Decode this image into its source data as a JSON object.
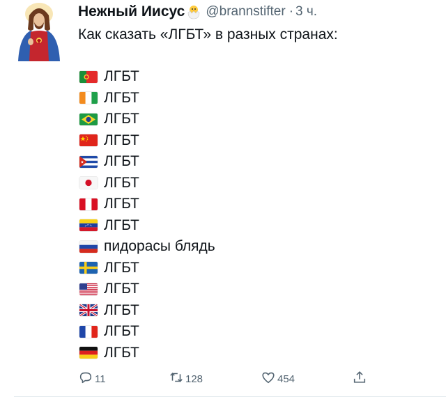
{
  "tweet": {
    "author_name": "Нежный Иисус",
    "author_emoji": "hatching-chick-emoji",
    "handle": "@brannstifter",
    "separator": "·",
    "time": "3 ч.",
    "intro": "Как сказать «ЛГБТ» в разных странах:",
    "lines": [
      {
        "flag": "portugal-flag",
        "text": "ЛГБТ"
      },
      {
        "flag": "ivory-coast-flag",
        "text": "ЛГБТ"
      },
      {
        "flag": "brazil-flag",
        "text": "ЛГБТ"
      },
      {
        "flag": "china-flag",
        "text": "ЛГБТ"
      },
      {
        "flag": "cuba-flag",
        "text": "ЛГБТ"
      },
      {
        "flag": "japan-flag",
        "text": "ЛГБТ"
      },
      {
        "flag": "peru-flag",
        "text": "ЛГБТ"
      },
      {
        "flag": "venezuela-flag",
        "text": "ЛГБТ"
      },
      {
        "flag": "russia-flag",
        "text": "пидорасы блядь"
      },
      {
        "flag": "sweden-flag",
        "text": "ЛГБТ"
      },
      {
        "flag": "usa-flag",
        "text": "ЛГБТ"
      },
      {
        "flag": "uk-flag",
        "text": "ЛГБТ"
      },
      {
        "flag": "france-flag",
        "text": "ЛГБТ"
      },
      {
        "flag": "germany-flag",
        "text": "ЛГБТ"
      }
    ],
    "actions": {
      "reply_icon": "reply-icon",
      "reply_count": "11",
      "retweet_icon": "retweet-icon",
      "retweet_count": "128",
      "like_icon": "heart-icon",
      "like_count": "454",
      "share_icon": "share-icon"
    },
    "colors": {
      "text": "#0f1419",
      "secondary": "#536471",
      "divider": "#e6ecf0"
    }
  }
}
